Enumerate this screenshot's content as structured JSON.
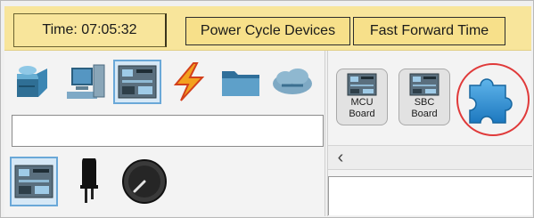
{
  "topbar": {
    "time_text": "Time: 07:05:32",
    "power_cycle_label": "Power Cycle Devices",
    "fast_forward_label": "Fast Forward Time"
  },
  "categories": [
    {
      "icon": "network-devices-icon",
      "selected": false
    },
    {
      "icon": "end-devices-icon",
      "selected": false
    },
    {
      "icon": "components-icon",
      "selected": true
    },
    {
      "icon": "connections-icon",
      "selected": false
    },
    {
      "icon": "miscellaneous-folder-icon",
      "selected": false
    },
    {
      "icon": "multiuser-cloud-icon",
      "selected": false
    }
  ],
  "subcategories": [
    {
      "icon": "boards-icon",
      "selected": true
    },
    {
      "icon": "actuators-icon",
      "selected": false
    },
    {
      "icon": "sensors-icon",
      "selected": false
    }
  ],
  "devices": [
    {
      "line1": "MCU",
      "line2": "Board"
    },
    {
      "line1": "SBC",
      "line2": "Board"
    }
  ],
  "highlight": {
    "icon": "puzzle-piece-icon",
    "ring_color": "#e03a3a"
  },
  "colors": {
    "topbar": "#f8e59b",
    "accent": "#2d8fd5"
  }
}
